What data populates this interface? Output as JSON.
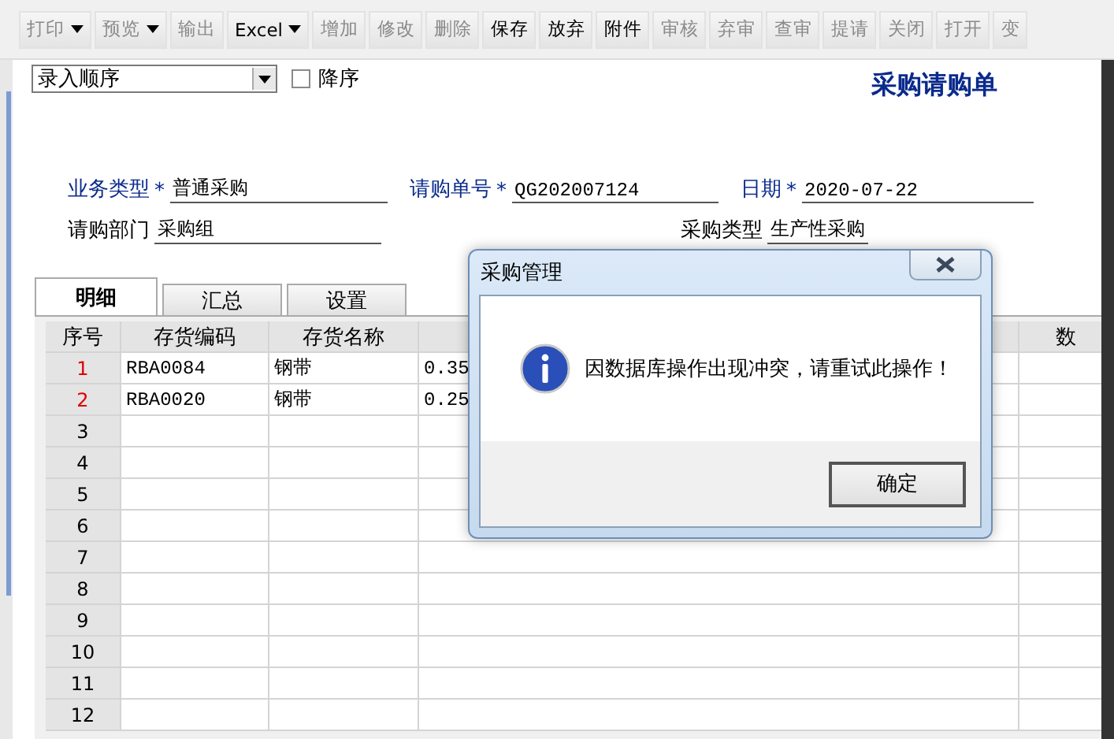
{
  "toolbar": [
    {
      "label": "打印",
      "dropdown": true,
      "disabled": true
    },
    {
      "label": "预览",
      "dropdown": true,
      "disabled": true
    },
    {
      "label": "输出",
      "dropdown": false,
      "disabled": true
    },
    {
      "label": "Excel",
      "dropdown": true,
      "disabled": false
    },
    {
      "label": "增加",
      "dropdown": false,
      "disabled": true
    },
    {
      "label": "修改",
      "dropdown": false,
      "disabled": true
    },
    {
      "label": "删除",
      "dropdown": false,
      "disabled": true
    },
    {
      "label": "保存",
      "dropdown": false,
      "disabled": false
    },
    {
      "label": "放弃",
      "dropdown": false,
      "disabled": false
    },
    {
      "label": "附件",
      "dropdown": false,
      "disabled": false
    },
    {
      "label": "审核",
      "dropdown": false,
      "disabled": true
    },
    {
      "label": "弃审",
      "dropdown": false,
      "disabled": true
    },
    {
      "label": "查审",
      "dropdown": false,
      "disabled": true
    },
    {
      "label": "提请",
      "dropdown": false,
      "disabled": true
    },
    {
      "label": "关闭",
      "dropdown": false,
      "disabled": true
    },
    {
      "label": "打开",
      "dropdown": false,
      "disabled": true
    },
    {
      "label": "变",
      "dropdown": false,
      "disabled": true
    }
  ],
  "sort": {
    "value": "录入顺序",
    "descending": {
      "label": "降序",
      "checked": false
    }
  },
  "title": "采购请购单",
  "header_rows": [
    [
      {
        "label": "业务类型",
        "required": true,
        "mark": "*",
        "value": "普通采购"
      },
      {
        "label": "请购单号",
        "required": true,
        "mark": "*",
        "value": "QG202007124"
      },
      {
        "label": "日期",
        "required": true,
        "mark": "*",
        "value": "2020-07-22"
      }
    ],
    [
      {
        "label": "请购部门",
        "required": false,
        "value": "采购组"
      },
      {
        "label": "采购类型",
        "required": false,
        "value": "生产性采购"
      }
    ]
  ],
  "tabs": [
    {
      "label": "明细",
      "selected": true
    },
    {
      "label": "汇总",
      "selected": false
    },
    {
      "label": "设置",
      "selected": false
    }
  ],
  "grid": {
    "columns": [
      {
        "label": "序号"
      },
      {
        "label": "存货编码"
      },
      {
        "label": "存货名称"
      },
      {},
      {
        "label": "数"
      }
    ],
    "rows": [
      {
        "number": "1",
        "modified": true,
        "cells": [
          "RBA0084",
          "钢带",
          "0.35"
        ]
      },
      {
        "number": "2",
        "modified": true,
        "cells": [
          "RBA0020",
          "钢带",
          "0.25"
        ]
      },
      {
        "number": "3",
        "modified": false
      },
      {
        "number": "4",
        "modified": false
      },
      {
        "number": "5",
        "modified": false
      },
      {
        "number": "6",
        "modified": false
      },
      {
        "number": "7",
        "modified": false
      },
      {
        "number": "8",
        "modified": false
      },
      {
        "number": "9",
        "modified": false
      },
      {
        "number": "10",
        "modified": false
      },
      {
        "number": "11",
        "modified": false
      },
      {
        "number": "12",
        "modified": false
      }
    ]
  },
  "dialog": {
    "title": "采购管理",
    "message": "因数据库操作出现冲突，请重试此操作！",
    "button": "确定"
  }
}
